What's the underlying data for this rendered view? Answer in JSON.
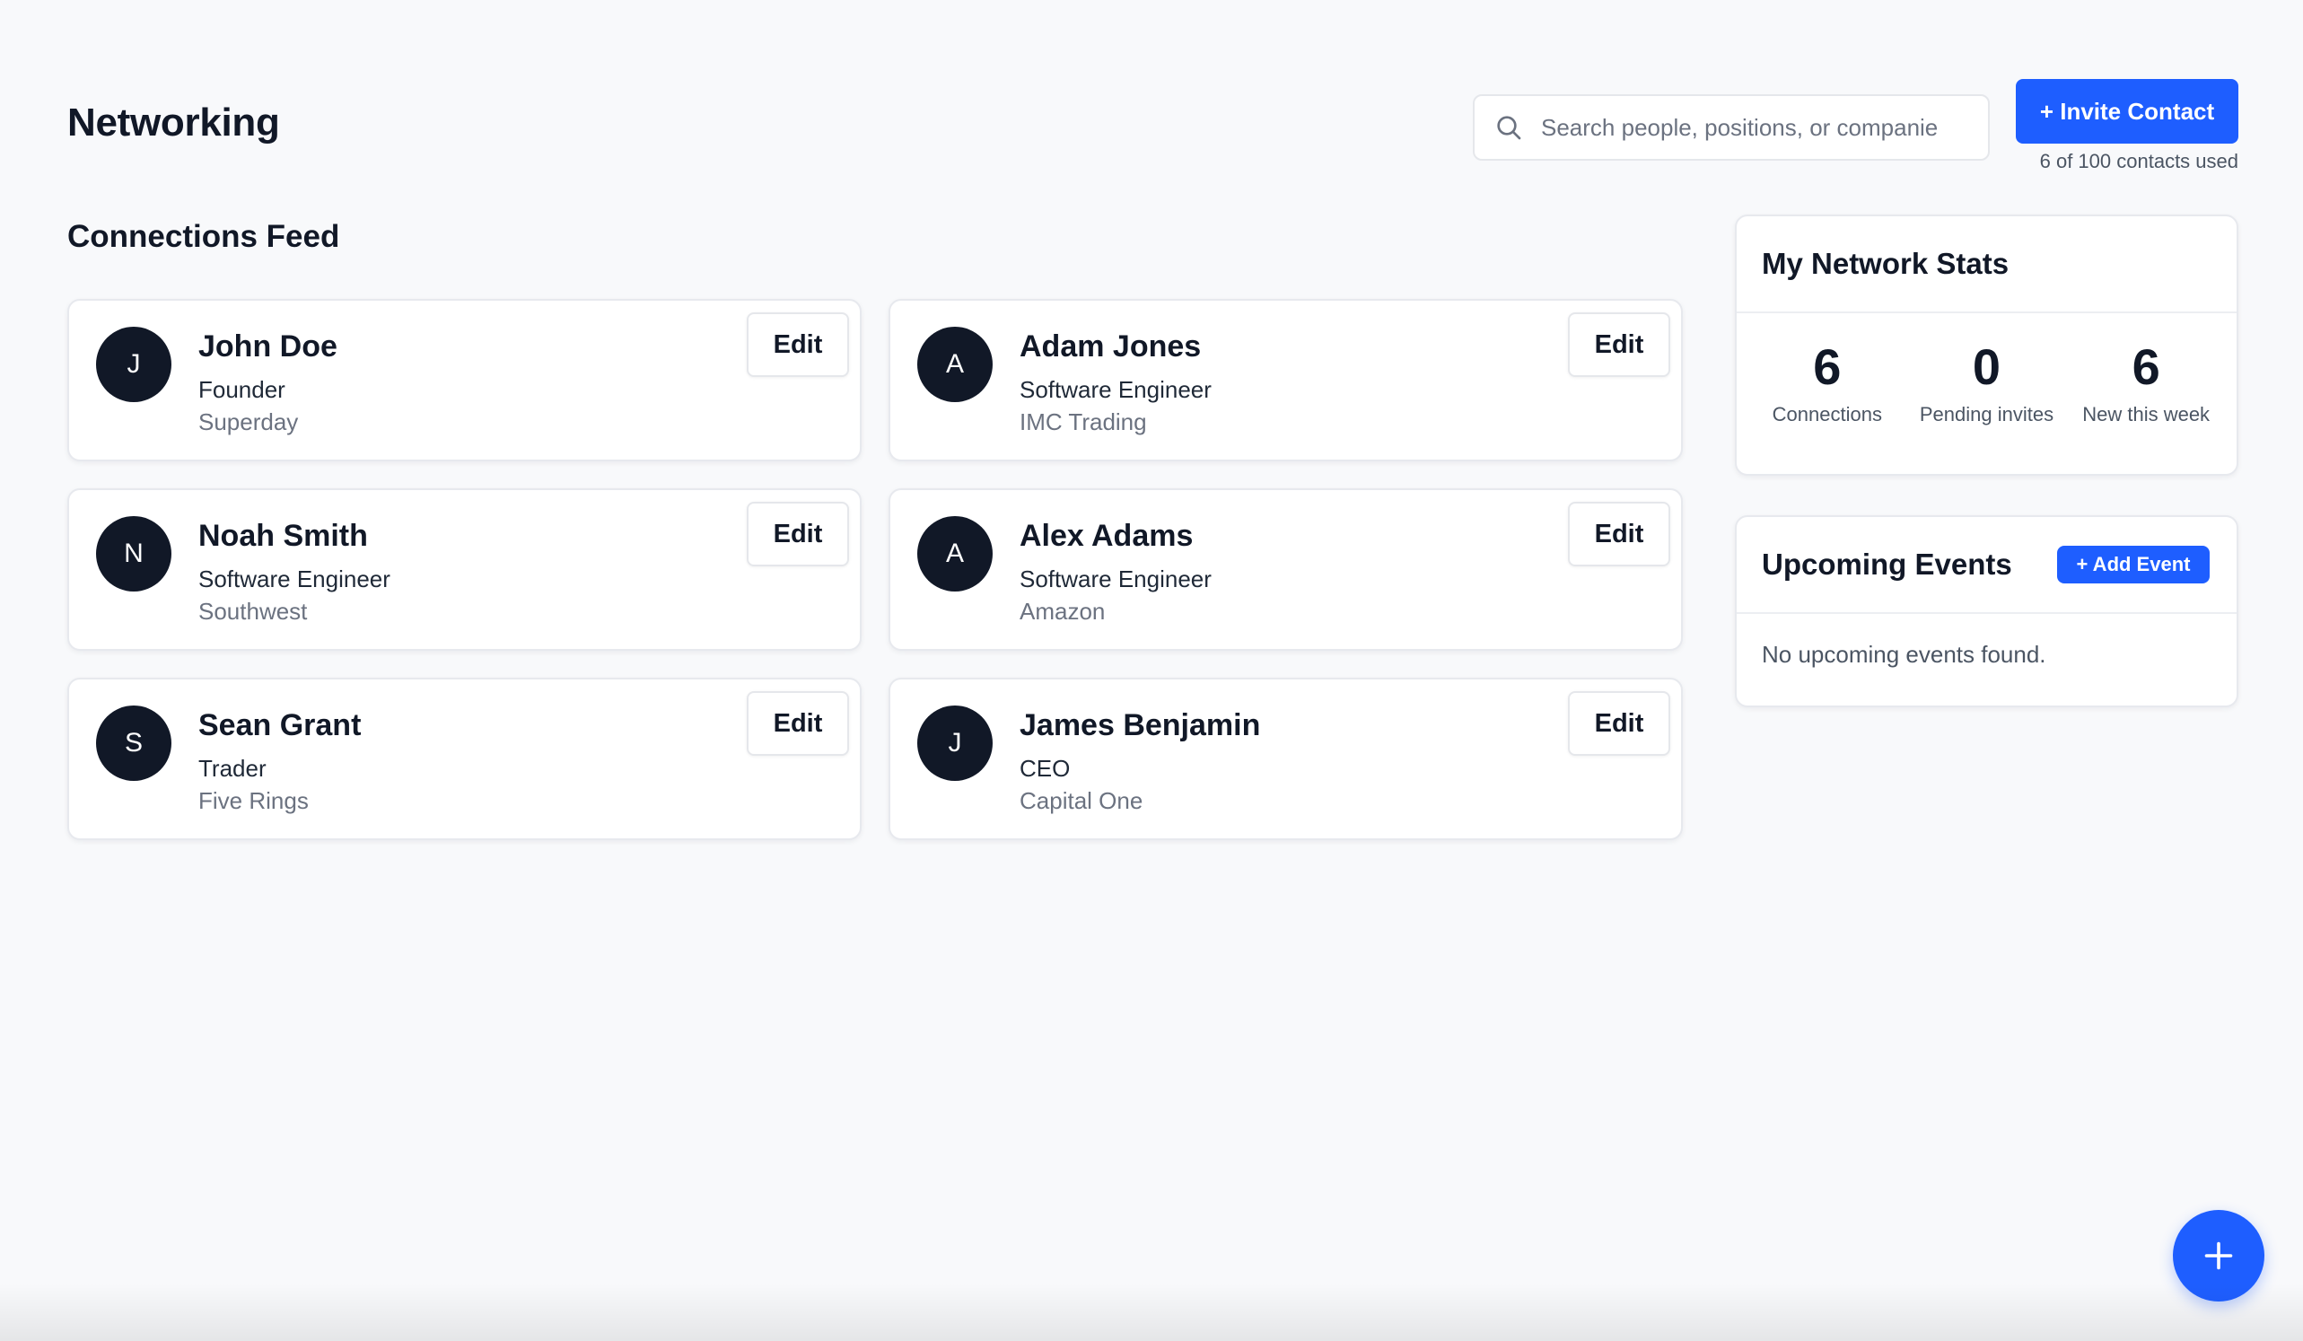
{
  "header": {
    "title": "Networking",
    "search_placeholder": "Search people, positions, or companie",
    "invite_label": "+ Invite Contact",
    "usage_text": "6 of 100 contacts used"
  },
  "feed": {
    "title": "Connections Feed",
    "edit_label": "Edit",
    "contacts": [
      {
        "initial": "J",
        "name": "John Doe",
        "position": "Founder",
        "company": "Superday"
      },
      {
        "initial": "A",
        "name": "Adam Jones",
        "position": "Software Engineer",
        "company": "IMC Trading"
      },
      {
        "initial": "N",
        "name": "Noah Smith",
        "position": "Software Engineer",
        "company": "Southwest"
      },
      {
        "initial": "A",
        "name": "Alex Adams",
        "position": "Software Engineer",
        "company": "Amazon"
      },
      {
        "initial": "S",
        "name": "Sean Grant",
        "position": "Trader",
        "company": "Five Rings"
      },
      {
        "initial": "J",
        "name": "James Benjamin",
        "position": "CEO",
        "company": "Capital One"
      }
    ]
  },
  "stats": {
    "title": "My Network Stats",
    "items": [
      {
        "value": "6",
        "label": "Connections"
      },
      {
        "value": "0",
        "label": "Pending invites"
      },
      {
        "value": "6",
        "label": "New this week"
      }
    ]
  },
  "events": {
    "title": "Upcoming Events",
    "add_label": "+ Add Event",
    "empty_text": "No upcoming events found."
  },
  "icons": {
    "search": "search-icon",
    "fab": "plus-icon"
  },
  "colors": {
    "accent": "#1e5eff",
    "avatar": "#111827",
    "background": "#f8f9fb"
  }
}
